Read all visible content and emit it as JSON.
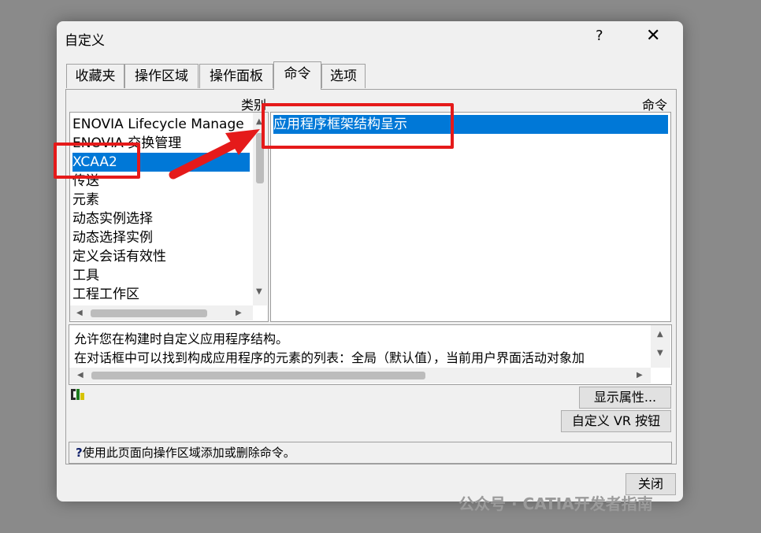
{
  "dialog": {
    "title": "自定义",
    "help_label": "?",
    "close_label": "✕"
  },
  "tabs": [
    {
      "label": "收藏夹"
    },
    {
      "label": "操作区域"
    },
    {
      "label": "操作面板"
    },
    {
      "label": "命令",
      "active": true
    },
    {
      "label": "选项"
    }
  ],
  "categories": {
    "header": "类别",
    "items": [
      "ENOVIA Lifecycle Manage",
      "ENOVIA 交换管理",
      "XCAA2",
      "传送",
      "元素",
      "动态实例选择",
      "动态选择实例",
      "定义会话有效性",
      "工具",
      "工程工作区"
    ],
    "selected": "XCAA2"
  },
  "commands": {
    "header": "命令",
    "items": [
      "应用程序框架结构呈示"
    ]
  },
  "description": {
    "line1": "允许您在构建时自定义应用程序结构。",
    "line2": "在对话框中可以找到构成应用程序的元素的列表：全局（默认值），当前用户界面活动对象加"
  },
  "buttons": {
    "show_properties": "显示属性...",
    "customize_vr": "自定义 VR 按钮",
    "close": "关闭"
  },
  "status": {
    "icon": "?",
    "text": "使用此页面向操作区域添加或删除命令。"
  },
  "watermark": "公众号 · CATIA开发者指南",
  "annotation_color": "#e51a1a"
}
